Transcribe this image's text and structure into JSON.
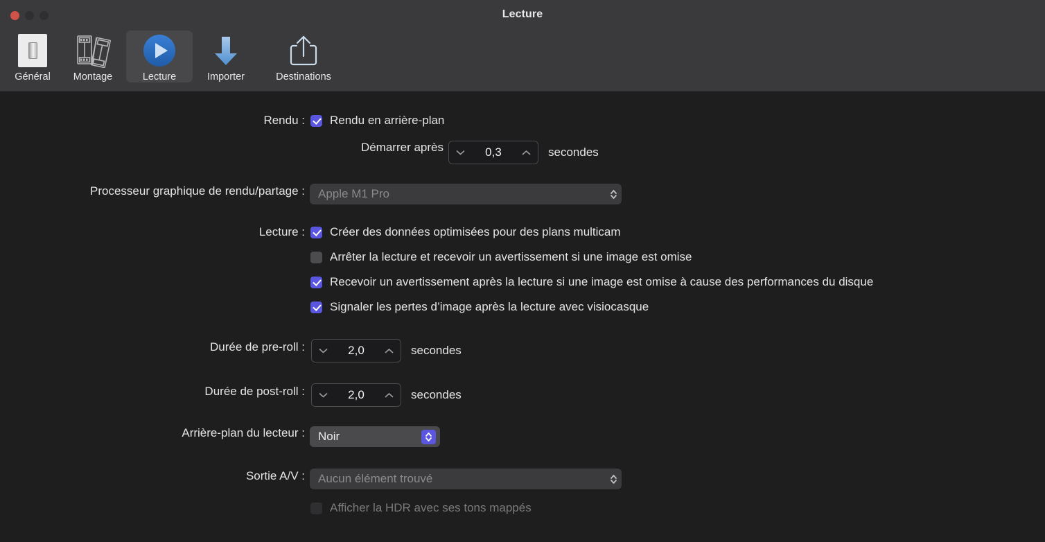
{
  "window": {
    "title": "Lecture",
    "traffic_lights": [
      "close",
      "minimize",
      "zoom"
    ]
  },
  "toolbar": {
    "tabs": [
      {
        "label": "Général",
        "icon": "light-switch-icon",
        "selected": false
      },
      {
        "label": "Montage",
        "icon": "film-strips-icon",
        "selected": false
      },
      {
        "label": "Lecture",
        "icon": "play-circle-icon",
        "selected": true
      },
      {
        "label": "Importer",
        "icon": "download-arrow-icon",
        "selected": false
      },
      {
        "label": "Destinations",
        "icon": "share-export-icon",
        "selected": false
      }
    ]
  },
  "settings": {
    "render": {
      "label": "Rendu :",
      "background_render": {
        "text": "Rendu en arrière-plan",
        "checked": true
      },
      "delay": {
        "label": "Démarrer après",
        "value": "0,3",
        "unit": "secondes"
      }
    },
    "gpu": {
      "label": "Processeur graphique de rendu/partage :",
      "value": "Apple M1 Pro",
      "disabled": true
    },
    "playback": {
      "label": "Lecture :",
      "options": [
        {
          "text": "Créer des données optimisées pour des plans multicam",
          "checked": true,
          "disabled": false
        },
        {
          "text": "Arrêter la lecture et recevoir un avertissement si une image est omise",
          "checked": false,
          "disabled": false
        },
        {
          "text": "Recevoir un avertissement après la lecture si une image est omise à cause des performances du disque",
          "checked": true,
          "disabled": false
        },
        {
          "text": "Signaler les pertes d’image après la lecture avec visiocasque",
          "checked": true,
          "disabled": false
        }
      ]
    },
    "preroll": {
      "label": "Durée de pre-roll :",
      "value": "2,0",
      "unit": "secondes"
    },
    "postroll": {
      "label": "Durée de post-roll :",
      "value": "2,0",
      "unit": "secondes"
    },
    "player_background": {
      "label": "Arrière-plan du lecteur :",
      "value": "Noir",
      "disabled": false
    },
    "av_output": {
      "label": "Sortie A/V :",
      "value": "Aucun élément trouvé",
      "disabled": true
    },
    "hdr": {
      "text": "Afficher la HDR avec ses tons mappés",
      "checked": false,
      "disabled": true
    }
  },
  "colors": {
    "accent": "#5a56e0",
    "toolbar_bg": "#3a3a3c",
    "content_bg": "#1e1e1e",
    "selected_tab_bg": "#48484a",
    "close_button": "#cf5348"
  }
}
